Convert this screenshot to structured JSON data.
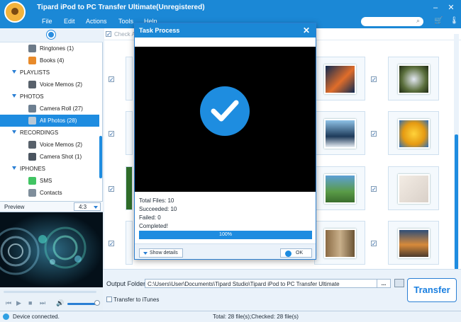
{
  "window": {
    "title": "Tipard iPod to PC Transfer Ultimate(Unregistered)",
    "controls": [
      "minimize",
      "close"
    ]
  },
  "menu": {
    "items": [
      "File",
      "Edit",
      "Actions",
      "Tools",
      "Help"
    ],
    "search_placeholder": "",
    "search_icon": "search-icon"
  },
  "sidebar": {
    "items": [
      {
        "label": "Ringtones (1)",
        "type": "item",
        "icon": "ringtone-icon"
      },
      {
        "label": "Books (4)",
        "type": "item",
        "icon": "books-icon"
      },
      {
        "label": "PLAYLISTS",
        "type": "category"
      },
      {
        "label": "Voice Memos (2)",
        "type": "item",
        "icon": "voice-memo-icon"
      },
      {
        "label": "PHOTOS",
        "type": "category"
      },
      {
        "label": "Camera Roll (27)",
        "type": "item",
        "icon": "camera-roll-icon"
      },
      {
        "label": "All Photos (28)",
        "type": "item",
        "icon": "photos-icon",
        "selected": true
      },
      {
        "label": "RECORDINGS",
        "type": "category"
      },
      {
        "label": "Voice Memos (2)",
        "type": "item",
        "icon": "voice-memo-icon"
      },
      {
        "label": "Camera Shot (1)",
        "type": "item",
        "icon": "camera-shot-icon"
      },
      {
        "label": "IPHONES",
        "type": "category"
      },
      {
        "label": "SMS",
        "type": "item",
        "icon": "sms-icon"
      },
      {
        "label": "Contacts",
        "type": "item",
        "icon": "contacts-icon"
      }
    ]
  },
  "preview": {
    "label": "Preview",
    "ratio": "4:3"
  },
  "grid": {
    "check_all": "Check All",
    "thumbs": [
      {
        "row": 0,
        "col": 4,
        "checked": true
      },
      {
        "row": 0,
        "col": 5,
        "checked": true
      },
      {
        "row": 1,
        "col": 4,
        "checked": true
      },
      {
        "row": 1,
        "col": 5,
        "checked": true
      },
      {
        "row": 2,
        "col": 4,
        "checked": true
      },
      {
        "row": 2,
        "col": 5,
        "checked": true
      },
      {
        "row": 3,
        "col": 4,
        "checked": true
      },
      {
        "row": 3,
        "col": 5,
        "checked": true
      }
    ]
  },
  "dialog": {
    "title": "Task Process",
    "total_files": "Total Files: 10",
    "succeeded": "Succeeded: 10",
    "failed": "Failed: 0",
    "completed": "Completed!",
    "progress_label": "100%",
    "progress_value": 1.0,
    "show_details": "Show details",
    "ok": "OK"
  },
  "output": {
    "label": "Output Folder:",
    "path": "C:\\Users\\User\\Documents\\Tipard Studio\\Tipard iPod to PC Transfer Ultimate",
    "more": "...",
    "transfer_itunes": "Transfer to iTunes",
    "transfer_button": "Transfer"
  },
  "status": {
    "device": "Device connected.",
    "totals": "Total: 28 file(s);Checked: 28 file(s)"
  }
}
